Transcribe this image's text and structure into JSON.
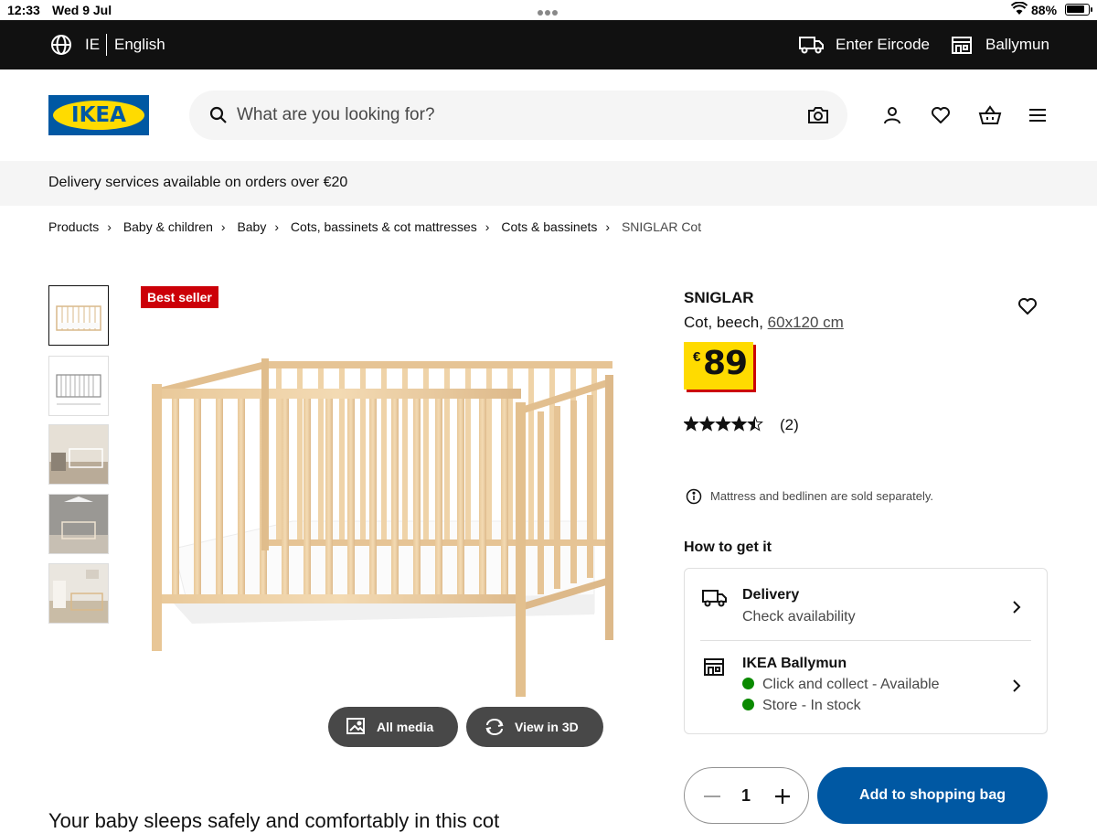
{
  "status_bar": {
    "time": "12:33",
    "date": "Wed 9 Jul",
    "battery": "88%",
    "battery_level": 0.88
  },
  "top_bar": {
    "country": "IE",
    "language": "English",
    "eircode": "Enter Eircode",
    "store": "Ballymun"
  },
  "header": {
    "logo": "IKEA",
    "search_placeholder": "What are you looking for?"
  },
  "banner": {
    "text": "Delivery services available on orders over €20"
  },
  "breadcrumb": {
    "items": [
      "Products",
      "Baby & children",
      "Baby",
      "Cots, bassinets & cot mattresses",
      "Cots & bassinets"
    ],
    "current": "SNIGLAR Cot"
  },
  "gallery": {
    "badge": "Best seller",
    "all_media": "All media",
    "view_3d": "View in 3D"
  },
  "product": {
    "name": "SNIGLAR",
    "description": "Cot, beech, ",
    "size": "60x120 cm",
    "currency": "€",
    "price": "89",
    "rating": 4.5,
    "review_count": "(2)",
    "note": "Mattress and bedlinen are sold separately.",
    "cut_off_text": "Your baby sleeps safely and comfortably in this cot"
  },
  "availability": {
    "heading": "How to get it",
    "delivery_title": "Delivery",
    "delivery_sub": "Check availability",
    "store_title": "IKEA Ballymun",
    "click_collect": "Click and collect - Available",
    "store_stock": "Store - In stock",
    "status_color": "#0a8a00"
  },
  "purchase": {
    "quantity": "1",
    "add_label": "Add to shopping bag"
  },
  "colors": {
    "brand_blue": "#0058a3",
    "brand_yellow": "#ffdb00",
    "badge_red": "#cc0008"
  }
}
